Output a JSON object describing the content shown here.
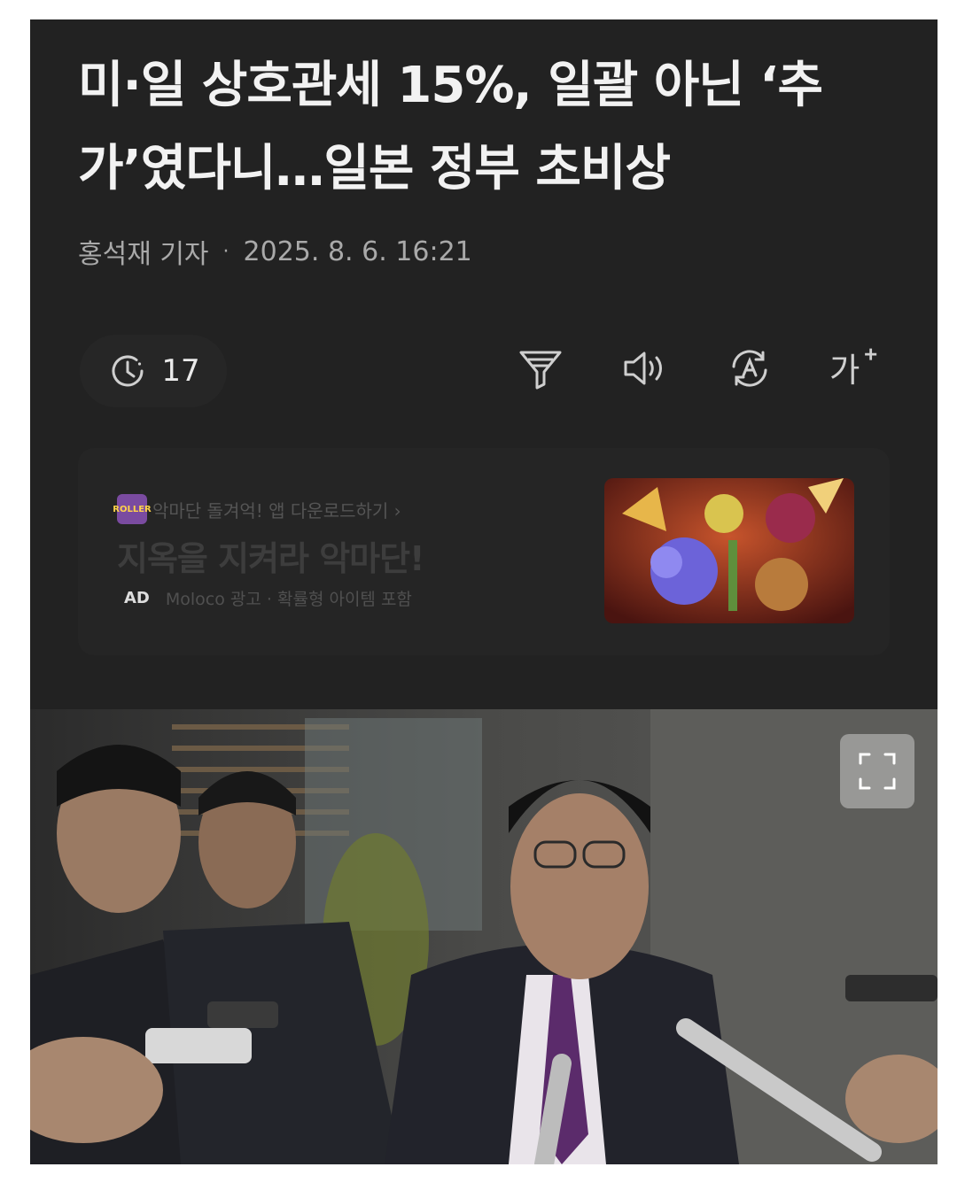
{
  "article": {
    "headline_line1": "미·일 상호관세 15%, 일괄 아닌 ‘추",
    "headline_line2": "가’였다니…일본 정부 초비상",
    "reporter": "홍석재 기자",
    "separator": "·",
    "datetime": "2025. 8. 6. 16:21"
  },
  "toolbar": {
    "read_time": "17",
    "icons": [
      "clock-icon",
      "filter-icon",
      "speaker-icon",
      "translate-icon",
      "font-size-icon"
    ],
    "font_size_label": "가"
  },
  "ad": {
    "cta": "악마단 돌겨억! 앱 다운로드하기 ›",
    "title": "지옥을 지켜라 악마단!",
    "badge": "AD",
    "advertiser": "Moloco 광고 · 확률형 아이템 포함",
    "logo_text": "ROLLER"
  },
  "photo": {
    "expand_icon": "expand-icon"
  }
}
